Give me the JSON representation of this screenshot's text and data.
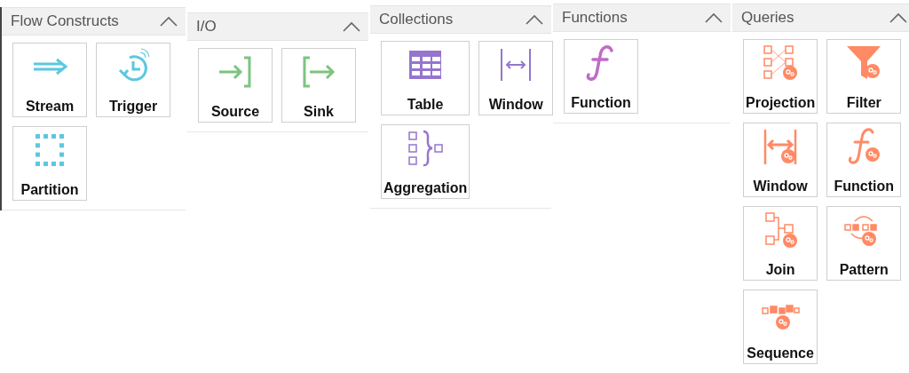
{
  "panels": [
    {
      "title": "Flow Constructs",
      "expanded": true,
      "items": [
        {
          "label": "Stream",
          "kind": "stream"
        },
        {
          "label": "Trigger",
          "kind": "trigger"
        },
        {
          "label": "Partition",
          "kind": "partition"
        }
      ]
    },
    {
      "title": "I/O",
      "expanded": true,
      "items": [
        {
          "label": "Source",
          "kind": "source"
        },
        {
          "label": "Sink",
          "kind": "sink"
        }
      ]
    },
    {
      "title": "Collections",
      "expanded": true,
      "items": [
        {
          "label": "Table",
          "kind": "table"
        },
        {
          "label": "Window",
          "kind": "window"
        },
        {
          "label": "Aggregation",
          "kind": "aggregation"
        }
      ]
    },
    {
      "title": "Functions",
      "expanded": true,
      "items": [
        {
          "label": "Function",
          "kind": "function"
        }
      ]
    },
    {
      "title": "Queries",
      "expanded": true,
      "items": [
        {
          "label": "Projection",
          "kind": "projection"
        },
        {
          "label": "Filter",
          "kind": "filter"
        },
        {
          "label": "Window",
          "kind": "qwindow"
        },
        {
          "label": "Function",
          "kind": "qfunction"
        },
        {
          "label": "Join",
          "kind": "join"
        },
        {
          "label": "Pattern",
          "kind": "pattern"
        },
        {
          "label": "Sequence",
          "kind": "sequence"
        }
      ]
    }
  ]
}
